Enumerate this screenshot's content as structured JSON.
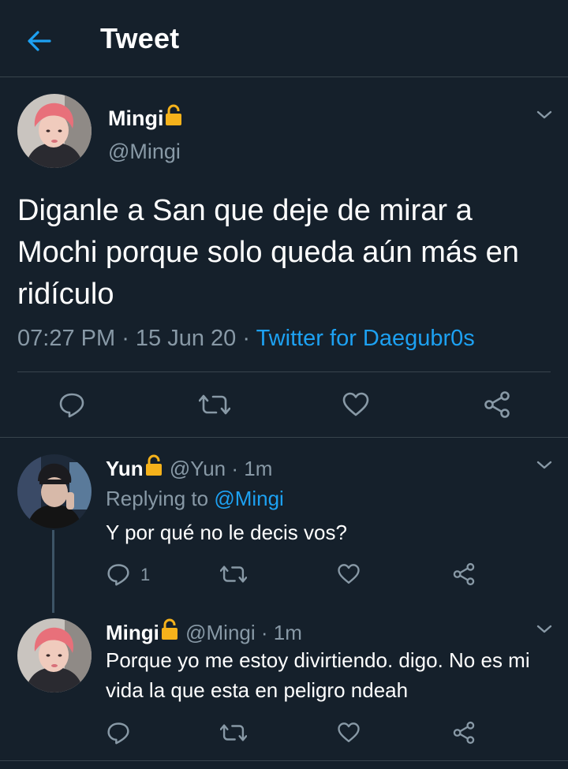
{
  "header": {
    "title": "Tweet",
    "back_icon": "arrow-left-icon"
  },
  "colors": {
    "background": "#15202b",
    "accent": "#1da1f2",
    "muted": "#8899a6",
    "divider": "#38444d",
    "lock": "#f5b21b"
  },
  "main_tweet": {
    "display_name": "Mingi",
    "handle": "@Mingi",
    "text": "Diganle a San que deje de mirar a Mochi porque solo queda aún más en ridículo",
    "time": "07:27 PM",
    "sep1": " · ",
    "date": "15 Jun 20",
    "sep2": " · ",
    "source": "Twitter for Daegubr0s"
  },
  "replies": [
    {
      "display_name": "Yun",
      "handle": "@Yun",
      "dot": " · ",
      "time": "1m",
      "replying_prefix": "Replying to ",
      "replying_to": "@Mingi",
      "text": "Y por qué no le decis vos?",
      "reply_count": "1"
    },
    {
      "display_name": "Mingi",
      "handle": "@Mingi",
      "dot": " · ",
      "time": "1m",
      "text": "Porque yo me estoy divirtiendo. digo. No es mi vida la que esta en peligro ndeah"
    }
  ]
}
